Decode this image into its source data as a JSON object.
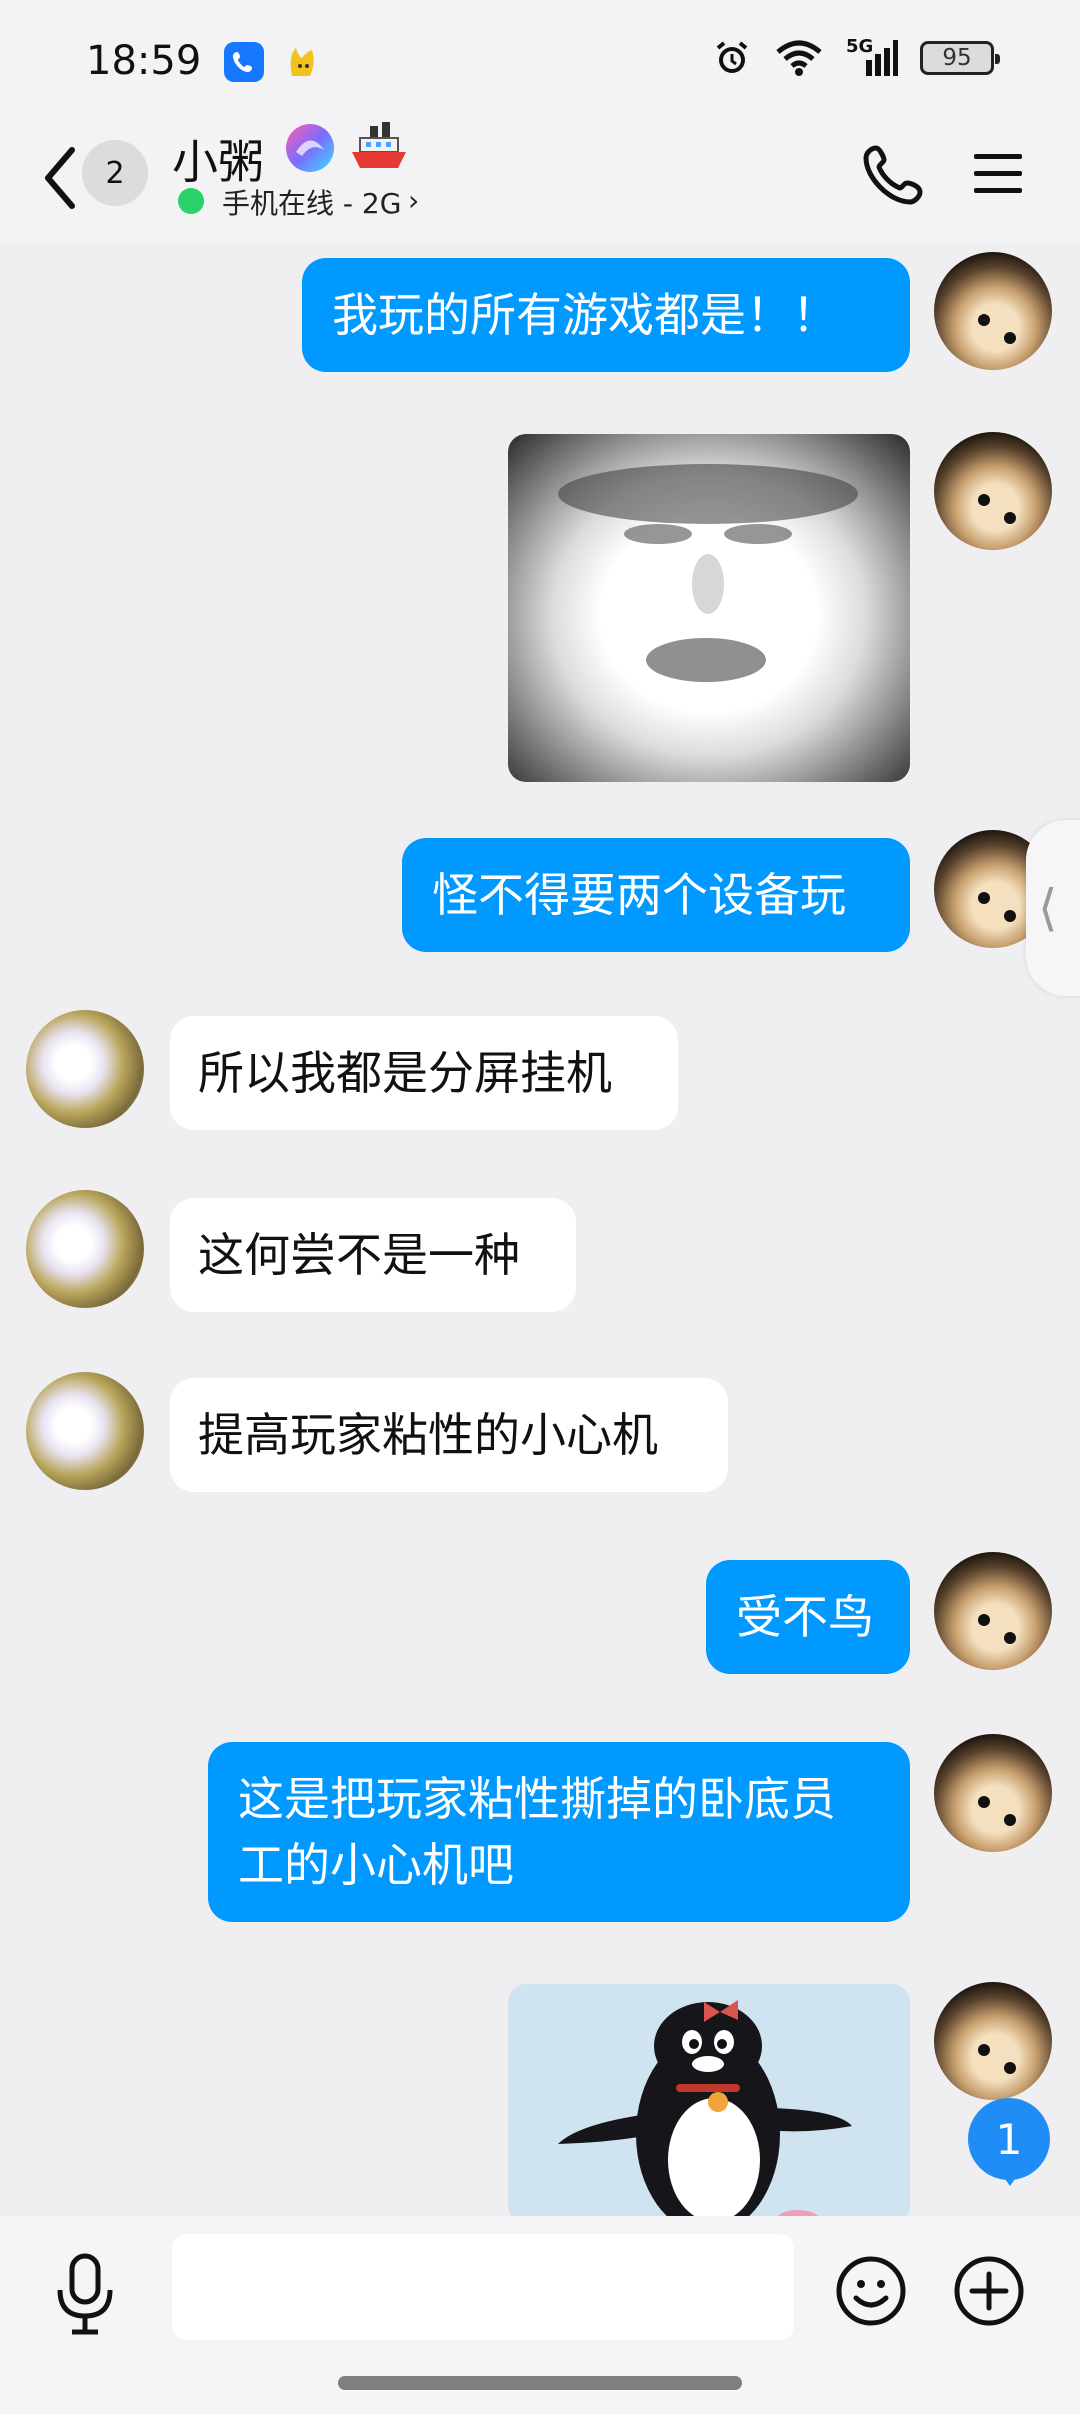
{
  "status_bar": {
    "time": "18:59",
    "network": "5G",
    "battery": "95"
  },
  "header": {
    "unread_count": "2",
    "contact_name": "小粥",
    "presence": "手机在线 - 2G",
    "online_color": "#2bd26a"
  },
  "messages": [
    {
      "side": "out",
      "type": "text",
      "text": "我玩的所有游戏都是！！"
    },
    {
      "side": "out",
      "type": "image",
      "desc": "face-sticker"
    },
    {
      "side": "out",
      "type": "text",
      "text": "怪不得要两个设备玩"
    },
    {
      "side": "in",
      "type": "text",
      "text": "所以我都是分屏挂机"
    },
    {
      "side": "in",
      "type": "text",
      "text": "这何尝不是一种"
    },
    {
      "side": "in",
      "type": "text",
      "text": "提高玩家粘性的小心机"
    },
    {
      "side": "out",
      "type": "text",
      "text": "受不鸟"
    },
    {
      "side": "out",
      "type": "text",
      "text": "这是把玩家粘性撕掉的卧底员工的小心机吧"
    },
    {
      "side": "out",
      "type": "image",
      "desc": "penguin-sticker"
    }
  ],
  "new_message_count": "1",
  "input": {
    "placeholder": "",
    "value": ""
  },
  "colors": {
    "outgoing_bubble": "#0099ff",
    "incoming_bubble": "#ffffff",
    "background": "#efeff1"
  }
}
